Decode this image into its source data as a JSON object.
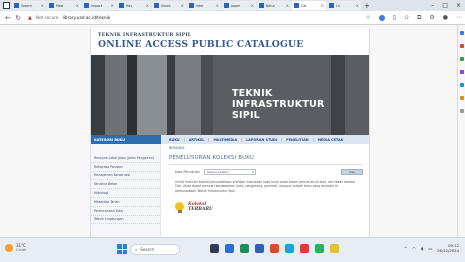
{
  "browser": {
    "tabs": [
      {
        "label": "Search"
      },
      {
        "label": "Mew"
      },
      {
        "label": "impact"
      },
      {
        "label": "Hay"
      },
      {
        "label": "Smart"
      },
      {
        "label": "inter"
      },
      {
        "label": "paper"
      },
      {
        "label": "Natur"
      },
      {
        "label": "Cat"
      },
      {
        "label": "Lir"
      },
      {
        "label": "I"
      }
    ],
    "tab_new": "+",
    "security_label": "Not secure",
    "url": "library.uad.ac.id/teknik",
    "window_controls": [
      "–",
      "□",
      "×"
    ]
  },
  "site": {
    "institution": "TEKNIK INFRASTRUKTUR SIPIL",
    "catalogue_title": "ONLINE ACCESS PUBLIC CATALOGUE",
    "banner": {
      "line1": "TEKNIK",
      "line2": "INFRASTRUKTUR",
      "line3": "SIPIL"
    },
    "sidebar_heading": "KATEGORI BUKU",
    "nav": [
      "BUKU",
      "ARTIKEL",
      "MULTIMEDIA",
      "LAPORAN STUDI",
      "PENELITIAN",
      "MEDIA CETAK"
    ],
    "sidebar_items": [
      "Rencana Lokal Jalan (Jalan Pengairan)",
      "Rekayasa Pondasi",
      "Manajemen Konstruksi",
      "Struktur Beton",
      "Hidrologi",
      "Mekanika Tanah",
      "Perencanaan Kota",
      "Teknik Lingkungan"
    ],
    "breadcrumb": "BERANDA",
    "section_title": "PENELUSURAN KOLEKSI BUKU",
    "search_label": "Kata Pencarian",
    "search_field": "Semua Koleksi",
    "search_button": "Cari",
    "description": "Untuk mencari koleksi perpustakaan silahkan masukkan kata kunci pada kolom pencarian di atas, lalu tekan tombol Cari. Anda dapat mencari berdasarkan judul, pengarang, penerbit, maupun subjek buku yang tersedia di perpustakaan Teknik Infrastruktur Sipil.",
    "new_books_line1": "Koleksi",
    "new_books_line2": "TERBARU"
  },
  "taskbar": {
    "weather_temp": "31°C",
    "weather_cond": "Cerah",
    "search_label": "Search",
    "time": "09.12",
    "date": "26/12/2024"
  },
  "colors": {
    "catalogue_blue": "#37598a",
    "nav_blue": "#2c6fb0",
    "banner_gray": "#55595e"
  }
}
